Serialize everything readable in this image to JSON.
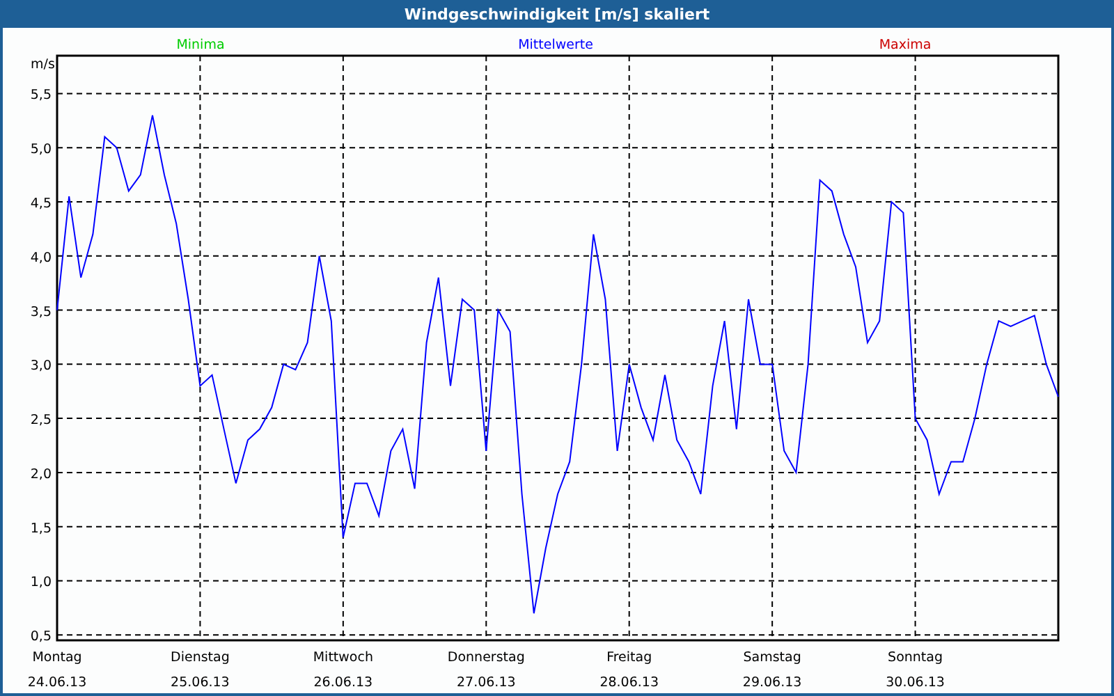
{
  "window": {
    "title": "Windgeschwindigkeit [m/s] skaliert"
  },
  "chart": {
    "legend": [
      {
        "label": "Minima",
        "color": "#00cc00"
      },
      {
        "label": "Mittelwerte",
        "color": "#0000ff"
      },
      {
        "label": "Maxima",
        "color": "#cc0000"
      }
    ],
    "dates": [
      "24.06.13",
      "25.06.13",
      "26.06.13",
      "27.06.13",
      "28.06.13",
      "29.06.13",
      "30.06.13"
    ],
    "chart_data": {
      "type": "line",
      "grid": true,
      "ylabel": "m/s",
      "ylim": [
        0.45,
        5.85
      ],
      "categories": [
        "Montag",
        null,
        null,
        null,
        null,
        null,
        null,
        null,
        null,
        null,
        null,
        null,
        "Dienstag",
        null,
        null,
        null,
        null,
        null,
        null,
        null,
        null,
        null,
        null,
        null,
        "Mittwoch",
        null,
        null,
        null,
        null,
        null,
        null,
        null,
        null,
        null,
        null,
        null,
        "Donnerstag",
        null,
        null,
        null,
        null,
        null,
        null,
        null,
        null,
        null,
        null,
        null,
        "Freitag",
        null,
        null,
        null,
        null,
        null,
        null,
        null,
        null,
        null,
        null,
        null,
        "Samstag",
        null,
        null,
        null,
        null,
        null,
        null,
        null,
        null,
        null,
        null,
        null,
        "Sonntag",
        null,
        null,
        null,
        null,
        null,
        null,
        null,
        null,
        null,
        null,
        null,
        null
      ],
      "series": [
        {
          "color": "#0000ff",
          "values": [
            3.5,
            4.55,
            3.8,
            4.2,
            5.1,
            5.0,
            4.6,
            4.75,
            5.3,
            4.75,
            4.3,
            3.6,
            2.8,
            2.9,
            2.4,
            1.9,
            2.3,
            2.4,
            2.6,
            3.0,
            2.95,
            3.2,
            4.0,
            3.4,
            1.4,
            1.9,
            1.9,
            1.6,
            2.2,
            2.4,
            1.85,
            3.2,
            3.8,
            2.8,
            3.6,
            3.5,
            2.2,
            3.5,
            3.3,
            1.8,
            0.7,
            1.3,
            1.8,
            2.1,
            3.0,
            4.2,
            3.6,
            2.2,
            3.0,
            2.6,
            2.3,
            2.9,
            2.3,
            2.1,
            1.8,
            2.8,
            3.4,
            2.4,
            3.6,
            3.0,
            3.0,
            2.2,
            2.0,
            3.0,
            4.7,
            4.6,
            4.2,
            3.9,
            3.2,
            3.4,
            4.5,
            4.4,
            2.5,
            2.3,
            1.8,
            2.1,
            2.1,
            2.5,
            3.0,
            3.4,
            3.35,
            3.4,
            3.45,
            3.0,
            2.7
          ]
        }
      ],
      "yticks": [
        {
          "value": 0.5,
          "label": "0,5"
        },
        {
          "value": 1.0,
          "label": "1,0"
        },
        {
          "value": 1.5,
          "label": "1,5"
        },
        {
          "value": 2.0,
          "label": "2,0"
        },
        {
          "value": 2.5,
          "label": "2,5"
        },
        {
          "value": 3.0,
          "label": "3,0"
        },
        {
          "value": 3.5,
          "label": "3,5"
        },
        {
          "value": 4.0,
          "label": "4,0"
        },
        {
          "value": 4.5,
          "label": "4,5"
        },
        {
          "value": 5.0,
          "label": "5,0"
        },
        {
          "value": 5.5,
          "label": "5,5"
        }
      ]
    }
  }
}
